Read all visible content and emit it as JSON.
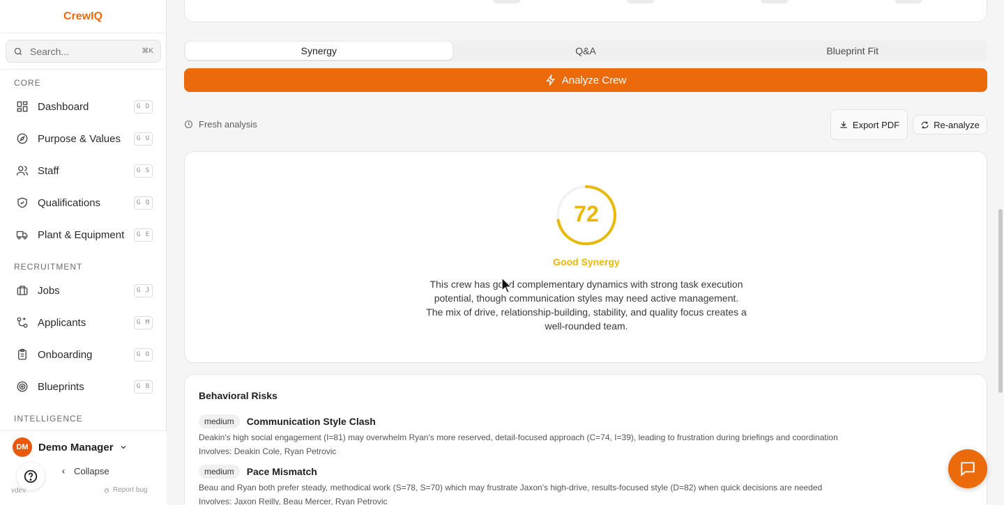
{
  "app": {
    "name": "CrewIQ"
  },
  "search": {
    "placeholder": "Search...",
    "shortcut": "⌘K"
  },
  "sidebar": {
    "sections": {
      "core": "CORE",
      "recruitment": "RECRUITMENT",
      "intelligence": "INTELLIGENCE"
    },
    "items": [
      {
        "label": "Dashboard",
        "key": "G D",
        "icon": "grid-icon"
      },
      {
        "label": "Purpose & Values",
        "key": "G U",
        "icon": "compass-icon"
      },
      {
        "label": "Staff",
        "key": "G S",
        "icon": "users-icon"
      },
      {
        "label": "Qualifications",
        "key": "G Q",
        "icon": "shield-check-icon"
      },
      {
        "label": "Plant & Equipment",
        "key": "G E",
        "icon": "truck-icon"
      },
      {
        "label": "Jobs",
        "key": "G J",
        "icon": "briefcase-icon"
      },
      {
        "label": "Applicants",
        "key": "G M",
        "icon": "workflow-icon"
      },
      {
        "label": "Onboarding",
        "key": "G O",
        "icon": "clipboard-icon"
      },
      {
        "label": "Blueprints",
        "key": "G B",
        "icon": "target-icon"
      }
    ]
  },
  "user": {
    "initials": "DM",
    "name": "Demo Manager"
  },
  "footer": {
    "collapse_label": "Collapse",
    "version": "vdev",
    "report_bug": "Report bug"
  },
  "tabs": [
    {
      "label": "Synergy",
      "active": true
    },
    {
      "label": "Q&A",
      "active": false
    },
    {
      "label": "Blueprint Fit",
      "active": false
    }
  ],
  "analyze": {
    "label": "Analyze Crew"
  },
  "status": {
    "fresh": "Fresh analysis"
  },
  "actions": {
    "export_label": "Export PDF",
    "reanalyze_label": "Re-analyze"
  },
  "synergy": {
    "score": "72",
    "score_fraction": 0.72,
    "label": "Good Synergy",
    "summary": "This crew has good complementary dynamics with strong task execution potential, though communication styles may need active management. The mix of drive, relationship-building, stability, and quality focus creates a well-rounded team."
  },
  "risks": {
    "title": "Behavioral Risks",
    "items": [
      {
        "severity": "medium",
        "name": "Communication Style Clash",
        "description": "Deakin's high social engagement (I=81) may overwhelm Ryan's more reserved, detail-focused approach (C=74, I=39), leading to frustration during briefings and coordination",
        "involves": "Involves: Deakin Cole, Ryan Petrovic"
      },
      {
        "severity": "medium",
        "name": "Pace Mismatch",
        "description": "Beau and Ryan both prefer steady, methodical work (S=78, S=70) which may frustrate Jaxon's high-drive, results-focused style (D=82) when quick decisions are needed",
        "involves": "Involves: Jaxon Reilly, Beau Mercer, Ryan Petrovic"
      }
    ]
  },
  "colors": {
    "accent": "#ea6a0c",
    "score": "#e8b90a"
  }
}
